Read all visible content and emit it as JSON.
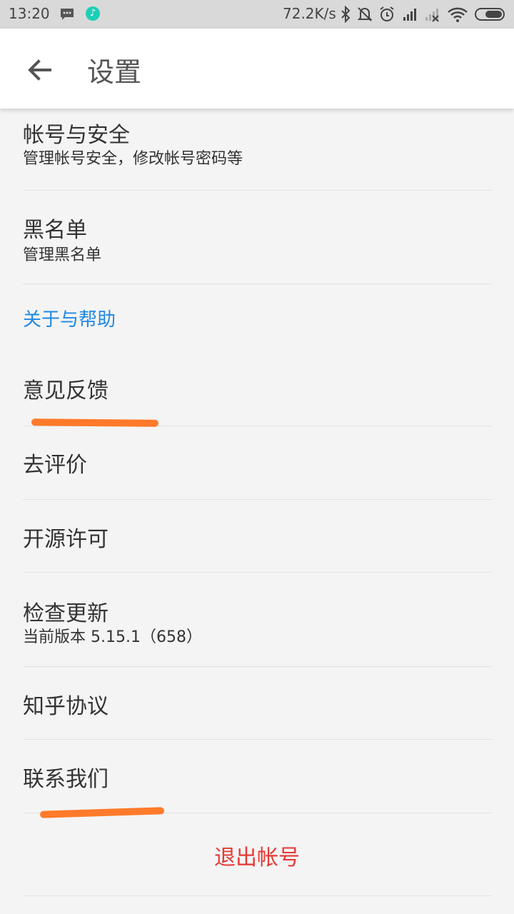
{
  "status_bar": {
    "time": "13:20",
    "speed": "72.2K/s",
    "icons": [
      "message-icon",
      "music-app-icon",
      "bluetooth-icon",
      "mute-icon",
      "alarm-icon",
      "signal-icon",
      "no-signal-icon",
      "wifi-icon",
      "battery-icon"
    ]
  },
  "toolbar": {
    "title": "设置",
    "back_icon": "arrow-left-icon"
  },
  "items": [
    {
      "title": "帐号与安全",
      "subtitle": "管理帐号安全，修改帐号密码等"
    },
    {
      "title": "黑名单",
      "subtitle": "管理黑名单"
    }
  ],
  "section_header": "关于与帮助",
  "about_items": [
    {
      "title": "意见反馈"
    },
    {
      "title": "去评价"
    },
    {
      "title": "开源许可"
    },
    {
      "title": "检查更新",
      "subtitle": "当前版本 5.15.1（658）"
    },
    {
      "title": "知乎协议"
    },
    {
      "title": "联系我们"
    }
  ],
  "logout_label": "退出帐号",
  "colors": {
    "accent": "#1e88e5",
    "danger": "#e53935",
    "highlight": "#ff7a2a"
  }
}
